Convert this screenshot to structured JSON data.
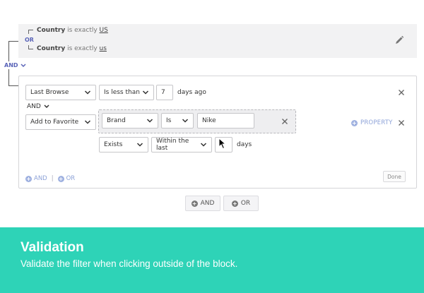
{
  "summary": {
    "row1": {
      "field": "Country",
      "op": "is exactly",
      "value": "US"
    },
    "connector": "OR",
    "row2": {
      "field": "Country",
      "op": "is exactly",
      "value": "us"
    }
  },
  "main_connector": "AND",
  "block": {
    "row1": {
      "event": "Last Browse",
      "operator": "Is less than",
      "value": "7",
      "unit": "days ago"
    },
    "connector": "AND",
    "row2": {
      "event": "Add to Favorite",
      "property": "Brand",
      "property_operator": "Is",
      "property_value": "Nike",
      "add_property": "PROPERTY",
      "exists": "Exists",
      "within": "Within the last",
      "within_value": "",
      "within_unit": "days"
    },
    "add_and": "AND",
    "add_or": "OR",
    "divider": "|",
    "done": "Done"
  },
  "global": {
    "and": "AND",
    "or": "OR"
  },
  "banner": {
    "title": "Validation",
    "subtitle": "Validate the filter when clicking outside of the block."
  },
  "colors": {
    "accent": "#5a64b8",
    "link": "#8ea3d8",
    "banner": "#2ed3b7"
  }
}
